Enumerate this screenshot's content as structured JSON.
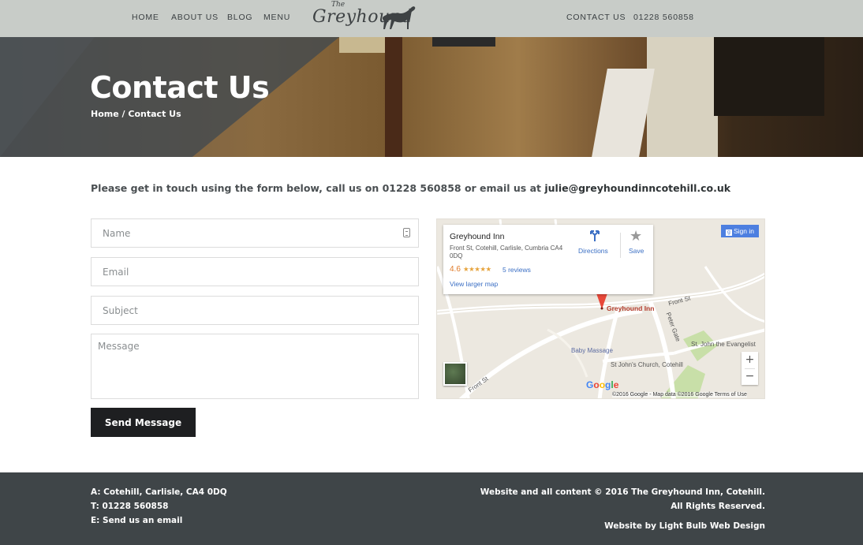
{
  "nav": {
    "left_items": [
      "HOME",
      "ABOUT US",
      "BLOG",
      "MENU"
    ],
    "right_items": [
      "CONTACT US",
      "01228 560858"
    ],
    "logo": {
      "small": "The",
      "main": "Greyhound"
    }
  },
  "hero": {
    "title": "Contact Us",
    "breadcrumb": {
      "home": "Home",
      "separator": "/",
      "current": "Contact Us"
    }
  },
  "intro": {
    "text": "Please get in touch using the form below, call us on 01228 560858 or email us at ",
    "email": "julie@greyhoundinncotehill.co.uk"
  },
  "form": {
    "name_placeholder": "Name",
    "email_placeholder": "Email",
    "subject_placeholder": "Subject",
    "message_placeholder": "Message",
    "send_label": "Send Message"
  },
  "map": {
    "place_name": "Greyhound Inn",
    "address": "Front St, Cotehill, Carlisle, Cumbria CA4 0DQ",
    "rating": "4.6",
    "stars": "★★★★★",
    "reviews": "5 reviews",
    "larger_map": "View larger map",
    "directions": "Directions",
    "save": "Save",
    "sign_in": "Sign in",
    "labels": {
      "pin": "Greyhound Inn",
      "front_st_top": "Front St",
      "front_st_bottom": "Front St",
      "peter_gate": "Peter Gate",
      "baby_massage": "Baby Massage",
      "st_johns_church": "St John's Church, Cotehill",
      "st_john_evangelist": "St. John the Evangelist"
    },
    "google": "Google",
    "attribution": "©2016 Google - Map data ©2016 Google   Terms of Use",
    "zoom_in": "+",
    "zoom_out": "−"
  },
  "footer": {
    "address": "A: Cotehill, Carlisle, CA4 0DQ",
    "phone": "T:  01228 560858",
    "email": "E: Send us an email",
    "copyright_line1": "Website and all content © 2016 The Greyhound Inn, Cotehill.",
    "copyright_line2": "All Rights Reserved.",
    "credit": "Website by Light Bulb Web Design"
  }
}
